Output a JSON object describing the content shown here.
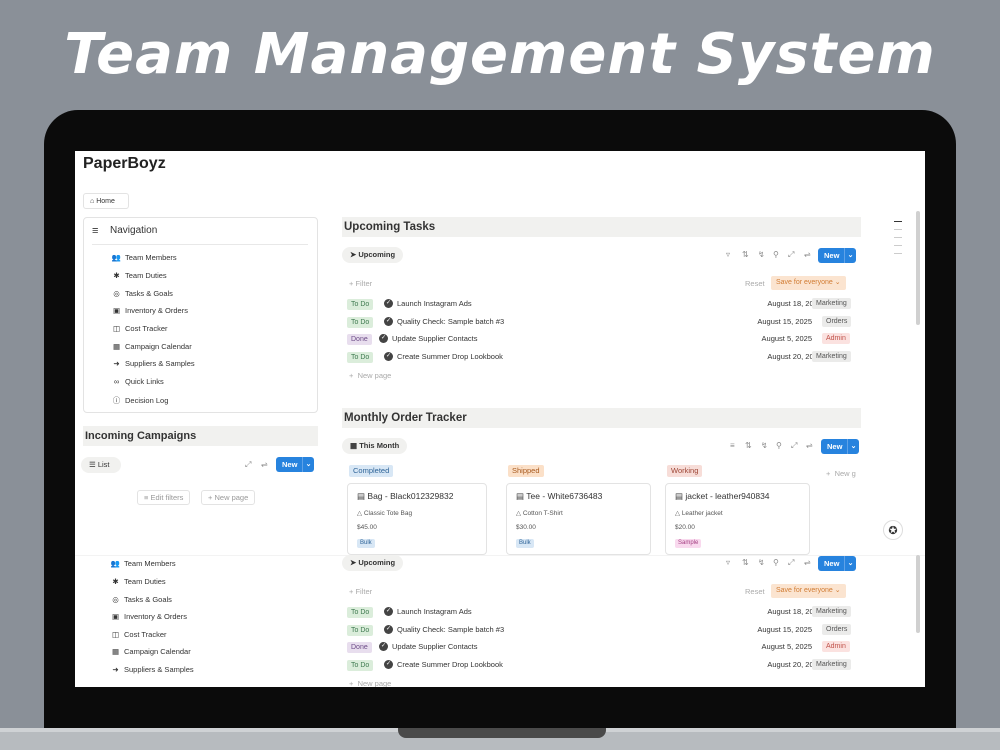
{
  "headline": "Team Management System",
  "app": {
    "brand": "PaperBoyz",
    "home": "Home"
  },
  "nav": {
    "title": "Navigation",
    "items": [
      {
        "label": "Team Members",
        "icon": "people-icon"
      },
      {
        "label": "Team Duties",
        "icon": "asterisk-icon"
      },
      {
        "label": "Tasks & Goals",
        "icon": "target-icon"
      },
      {
        "label": "Inventory & Orders",
        "icon": "box-icon"
      },
      {
        "label": "Cost Tracker",
        "icon": "money-icon"
      },
      {
        "label": "Campaign Calendar",
        "icon": "calendar-icon"
      },
      {
        "label": "Suppliers & Samples",
        "icon": "door-icon"
      },
      {
        "label": "Quick Links",
        "icon": "link-icon"
      },
      {
        "label": "Decision Log",
        "icon": "info-icon"
      }
    ]
  },
  "campaigns": {
    "title": "Incoming Campaigns",
    "view": "List",
    "new": "New",
    "edit_filters": "Edit filters",
    "new_page": "New page"
  },
  "tasks": {
    "title": "Upcoming Tasks",
    "view": "Upcoming",
    "new": "New",
    "filter": "Filter",
    "reset": "Reset",
    "save": "Save for everyone",
    "new_page": "New page",
    "rows": [
      {
        "status": "To Do",
        "task": "Launch Instagram Ads",
        "date": "August 18, 2025",
        "tag": "Marketing"
      },
      {
        "status": "To Do",
        "task": "Quality Check: Sample batch #3",
        "date": "August 15, 2025",
        "tag": "Orders"
      },
      {
        "status": "Done",
        "task": "Update Supplier Contacts",
        "date": "August 5, 2025",
        "tag": "Admin"
      },
      {
        "status": "To Do",
        "task": "Create Summer Drop Lookbook",
        "date": "August 20, 2025",
        "tag": "Marketing"
      }
    ]
  },
  "orders": {
    "title": "Monthly Order Tracker",
    "view": "This Month",
    "new": "New",
    "new_group": "New g",
    "groups": [
      {
        "label": "Completed",
        "card": {
          "title": "Bag - Black012329832",
          "item": "Classic Tote Bag",
          "price": "$45.00",
          "tag": "Bulk"
        }
      },
      {
        "label": "Shipped",
        "card": {
          "title": "Tee - White6736483",
          "item": "Cotton T-Shirt",
          "price": "$30.00",
          "tag": "Bulk"
        }
      },
      {
        "label": "Working",
        "card": {
          "title": "jacket - leather940834",
          "item": "Leather jacket",
          "price": "$20.00",
          "tag": "Sample"
        }
      }
    ]
  },
  "colors": {
    "accent": "#2783de",
    "background": "#8a9098"
  }
}
